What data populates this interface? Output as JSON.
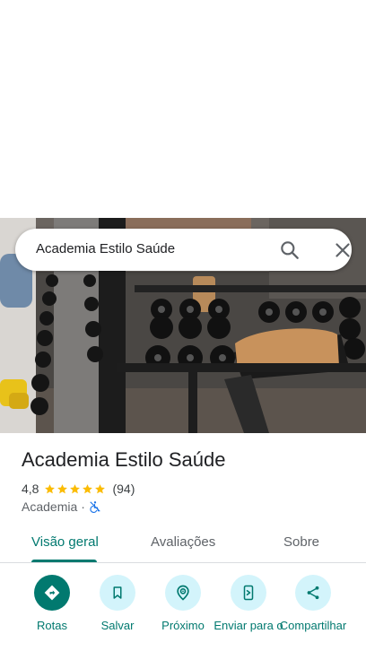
{
  "search": {
    "query": "Academia Estilo Saúde",
    "search_icon": "search-icon",
    "close_icon": "close-icon"
  },
  "photo": {
    "subject": "gym-interior-photo"
  },
  "place": {
    "name": "Academia Estilo Saúde",
    "rating": "4,8",
    "stars": 5,
    "review_count": "(94)",
    "category": "Academia",
    "separator": "·",
    "accessibility_icon": "not-wheelchair-accessible-icon"
  },
  "tabs": [
    {
      "label": "Visão geral",
      "active": true
    },
    {
      "label": "Avaliações",
      "active": false
    },
    {
      "label": "Sobre",
      "active": false
    }
  ],
  "actions": [
    {
      "label": "Rotas",
      "icon": "directions-icon"
    },
    {
      "label": "Salvar",
      "icon": "bookmark-icon"
    },
    {
      "label": "Próximo",
      "icon": "nearby-icon"
    },
    {
      "label": "Enviar para o",
      "icon": "send-to-phone-icon"
    },
    {
      "label": "Compartilhar",
      "icon": "share-icon"
    }
  ],
  "colors": {
    "accent": "#01796f",
    "action_bg": "#d3f4fb",
    "star": "#fbbc04",
    "text_primary": "#202124",
    "text_secondary": "#5f6368"
  }
}
